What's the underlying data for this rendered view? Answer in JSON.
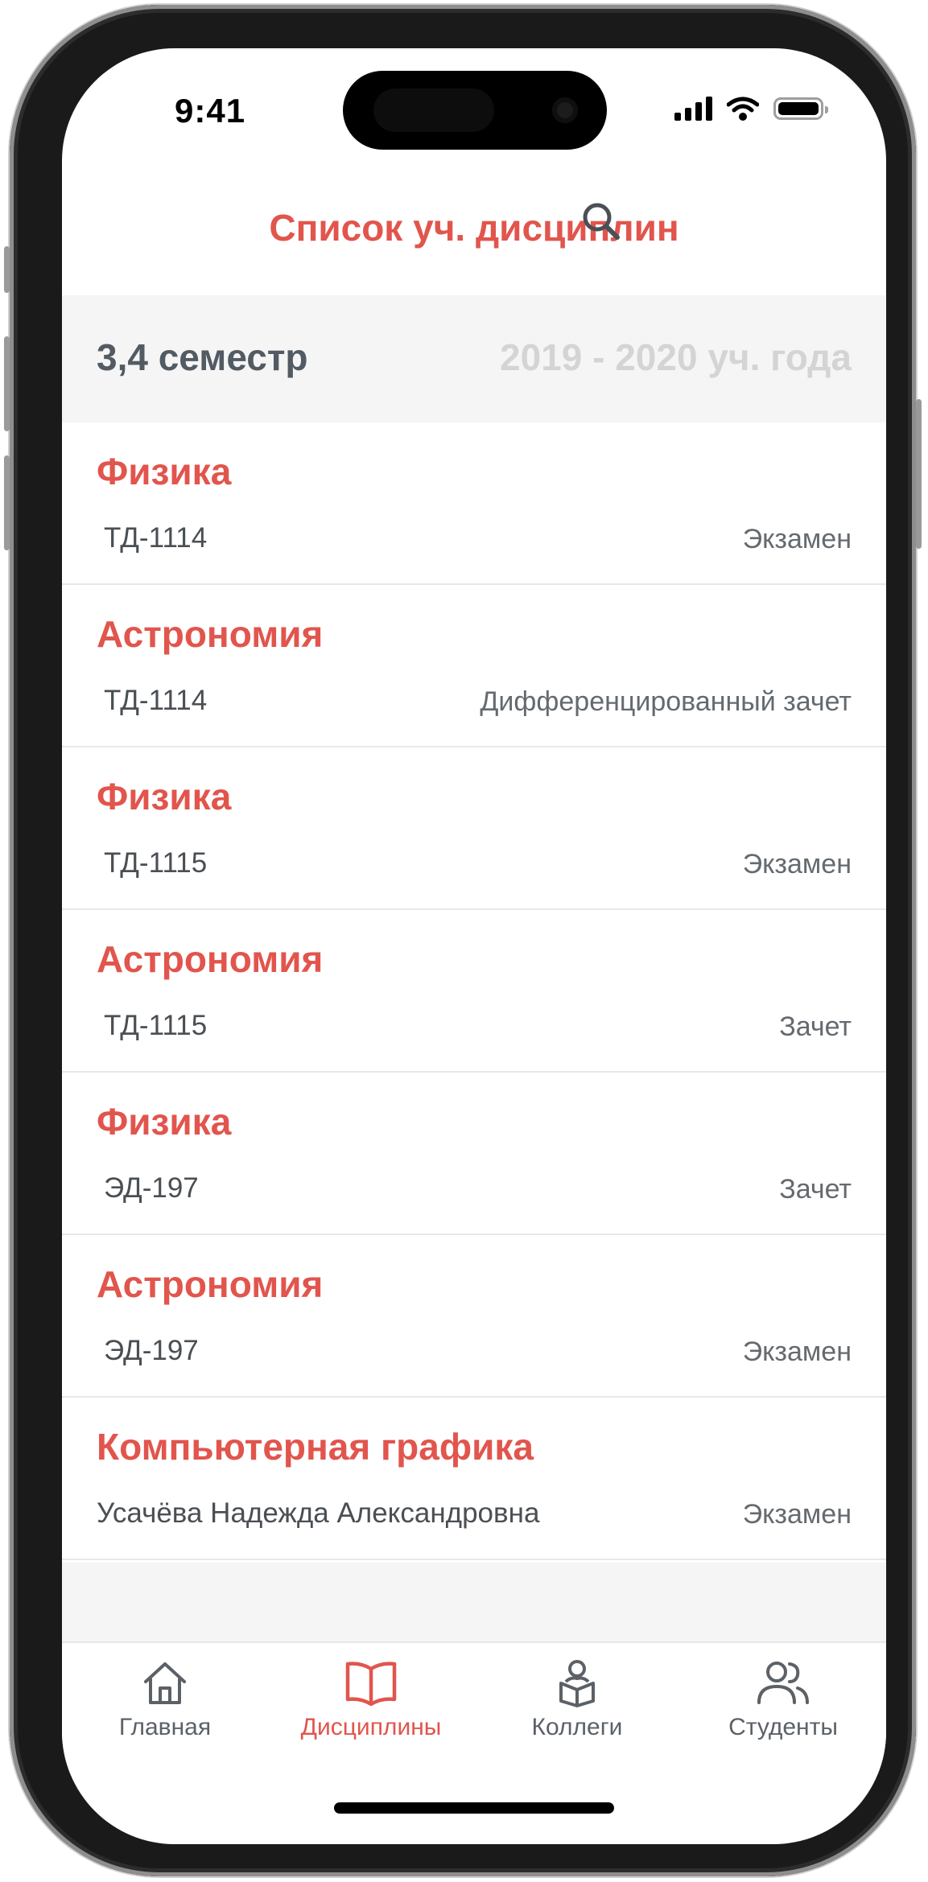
{
  "status_bar": {
    "time": "9:41"
  },
  "header": {
    "title": "Список уч. дисциплин"
  },
  "semester": {
    "label": "3,4 семестр",
    "year": "2019 - 2020 уч. года"
  },
  "disciplines": [
    {
      "title": "Физика",
      "group": "ТД-1114",
      "type": "Экзамен"
    },
    {
      "title": "Астрономия",
      "group": "ТД-1114",
      "type": "Дифференцированный зачет"
    },
    {
      "title": "Физика",
      "group": "ТД-1115",
      "type": "Экзамен"
    },
    {
      "title": "Астрономия",
      "group": "ТД-1115",
      "type": "Зачет"
    },
    {
      "title": "Физика",
      "group": "ЭД-197",
      "type": "Зачет"
    },
    {
      "title": "Астрономия",
      "group": "ЭД-197",
      "type": "Экзамен"
    },
    {
      "title": "Компьютерная графика",
      "group": "Усачёва Надежда Александровна",
      "type": "Экзамен"
    }
  ],
  "tabs": [
    {
      "label": "Главная",
      "icon": "home-icon",
      "active": false
    },
    {
      "label": "Дисциплины",
      "icon": "book-icon",
      "active": true
    },
    {
      "label": "Коллеги",
      "icon": "reader-icon",
      "active": false
    },
    {
      "label": "Студенты",
      "icon": "users-icon",
      "active": false
    }
  ],
  "colors": {
    "accent": "#e1554d",
    "text_dark": "#525b63",
    "muted": "#d4d4d4",
    "band": "#f5f5f5"
  }
}
